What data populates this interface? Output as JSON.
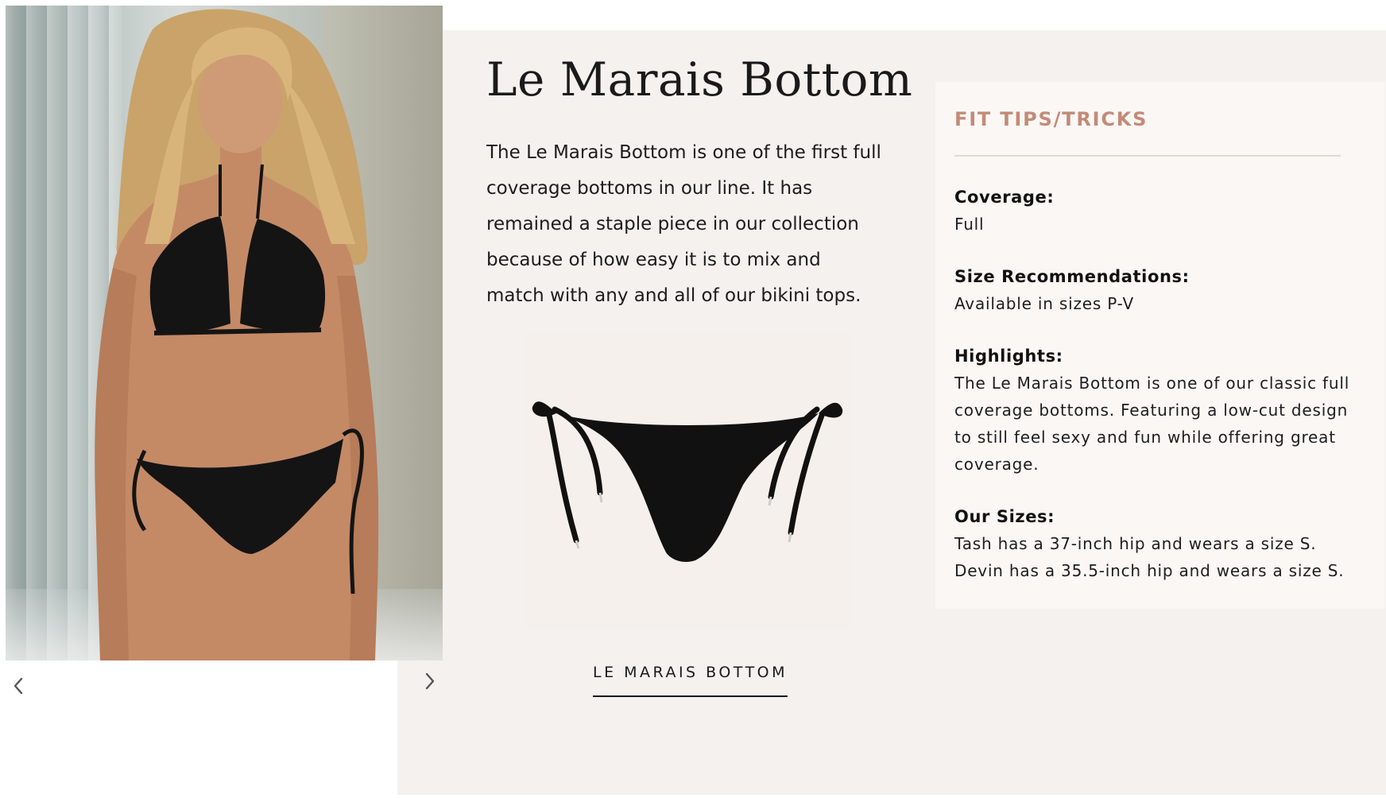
{
  "product": {
    "title": "Le Marais Bottom",
    "description": "The Le Marais Bottom is one of the first full coverage bottoms in our line. It has remained a staple piece in our collection because of how easy it is to mix and match with any and all of our bikini tops.",
    "tile_label": "LE MARAIS BOTTOM"
  },
  "gallery": {
    "prev_icon": "chevron-left-icon",
    "next_icon": "chevron-right-icon"
  },
  "fit_tips": {
    "heading": "FIT TIPS/TRICKS",
    "coverage_label": "Coverage:",
    "coverage_value": "Full",
    "size_label": "Size Recommendations:",
    "size_value": "Available in sizes P-V",
    "highlights_label": "Highlights:",
    "highlights_value": "The Le Marais Bottom is one of our classic full coverage bottoms. Featuring a low-cut design to still feel sexy and fun while offering great coverage.",
    "our_sizes_label": "Our Sizes:",
    "our_sizes_line1": "Tash has a 37-inch hip and wears a size S.",
    "our_sizes_line2": "Devin has a 35.5-inch hip and wears a size S."
  },
  "colors": {
    "panel_bg": "#f5f1ee",
    "card_bg": "#faf7f5",
    "accent": "#c38b77",
    "text": "#1a1a1a"
  }
}
